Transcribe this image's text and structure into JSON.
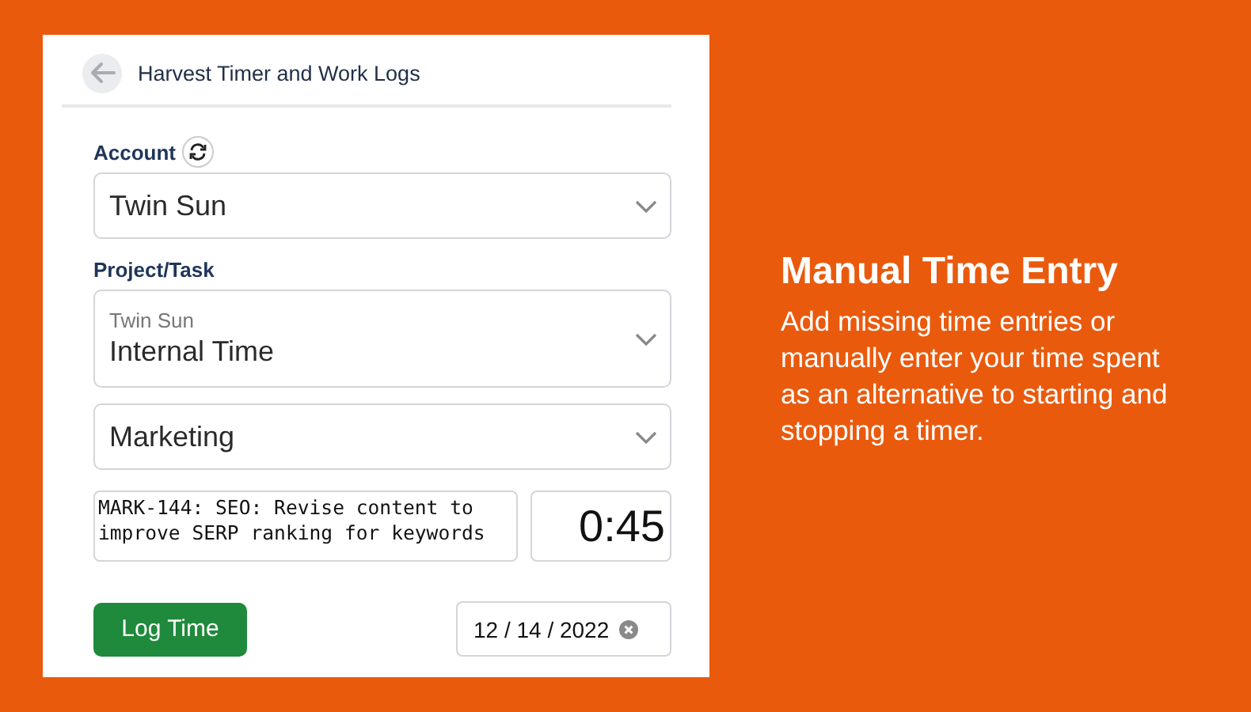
{
  "header": {
    "title": "Harvest Timer and Work Logs"
  },
  "account": {
    "label": "Account",
    "value": "Twin Sun"
  },
  "project": {
    "label": "Project/Task",
    "client": "Twin Sun",
    "value": "Internal Time"
  },
  "task": {
    "value": "Marketing"
  },
  "notes": {
    "value": "MARK-144: SEO: Revise content to improve SERP ranking for keywords"
  },
  "duration": {
    "value": "0:45"
  },
  "log_button": {
    "label": "Log Time"
  },
  "date": {
    "value": "12 / 14 / 2022"
  },
  "promo": {
    "title": "Manual Time Entry",
    "description": "Add missing time entries or manually enter your time spent as an alternative to starting and stopping a timer."
  }
}
